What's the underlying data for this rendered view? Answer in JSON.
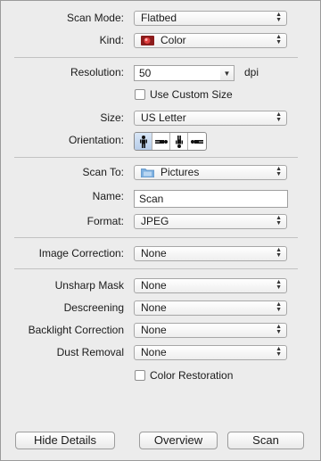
{
  "scan_mode": {
    "label": "Scan Mode:",
    "value": "Flatbed"
  },
  "kind": {
    "label": "Kind:",
    "value": "Color"
  },
  "resolution": {
    "label": "Resolution:",
    "value": "50",
    "unit": "dpi"
  },
  "use_custom_size": {
    "label": "Use Custom Size",
    "checked": false
  },
  "size": {
    "label": "Size:",
    "value": "US Letter"
  },
  "orientation": {
    "label": "Orientation:",
    "options": [
      "portrait-upright-icon",
      "landscape-left-icon",
      "portrait-inverted-icon",
      "landscape-right-icon"
    ],
    "selected_index": 0
  },
  "scan_to": {
    "label": "Scan To:",
    "value": "Pictures"
  },
  "name": {
    "label": "Name:",
    "value": "Scan"
  },
  "format": {
    "label": "Format:",
    "value": "JPEG"
  },
  "image_correction": {
    "label": "Image Correction:",
    "value": "None"
  },
  "unsharp_mask": {
    "label": "Unsharp Mask",
    "value": "None"
  },
  "descreening": {
    "label": "Descreening",
    "value": "None"
  },
  "backlight_correction": {
    "label": "Backlight Correction",
    "value": "None"
  },
  "dust_removal": {
    "label": "Dust Removal",
    "value": "None"
  },
  "color_restoration": {
    "label": "Color Restoration",
    "checked": false
  },
  "buttons": {
    "hide_details": "Hide Details",
    "overview": "Overview",
    "scan": "Scan"
  }
}
